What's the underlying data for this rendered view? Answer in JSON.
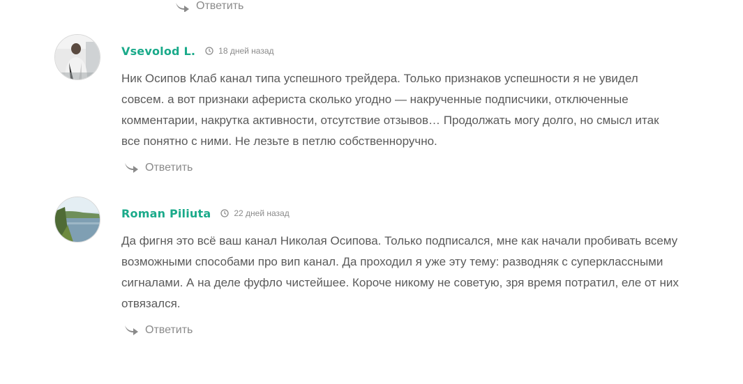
{
  "reply_label": "Ответить",
  "comments": [
    {
      "author": "Vsevolod L.",
      "date": "18 дней назад",
      "lines": [
        "Ник Осипов Клаб канал типа успешного трейдера. Только признаков успешности я не увидел",
        "совсем. а вот признаки афериста сколько угодно — накрученные подписчики, отключенные",
        "комментарии, накрутка активности, отсутствие отзывов… Продолжать могу долго, но смысл итак",
        "все понятно с ними. Не лезьте в петлю собственноручно."
      ]
    },
    {
      "author": "Roman Piliuta",
      "date": "22 дней назад",
      "lines": [
        "Да фигня это всё ваш канал Николая Осипова. Только подписался, мне как начали пробивать всему",
        "возможными способами про вип канал. Да проходил я уже эту тему: разводняк с суперклассными",
        "сигналами. А на деле фуфло чистейшее. Короче никому не советую, зря время потратил, еле от них",
        "отвязался."
      ]
    }
  ],
  "colors": {
    "author": "#1aaa8a",
    "text": "#5a5a5a",
    "muted": "#8a8a8a"
  },
  "icons": {
    "reply": "reply-arrow-icon",
    "clock": "clock-icon"
  }
}
